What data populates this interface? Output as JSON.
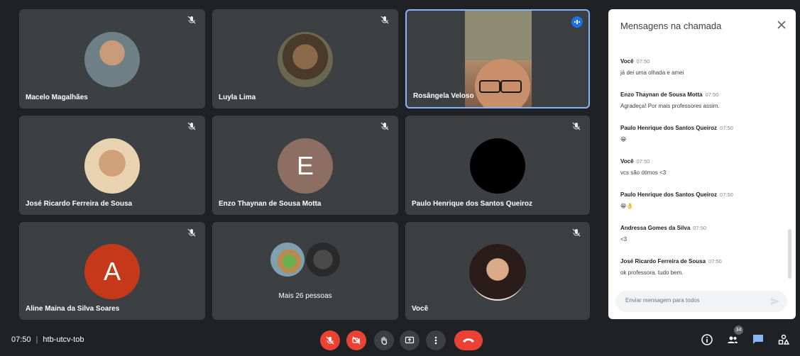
{
  "participants": [
    {
      "name": "Macelo Magalhães"
    },
    {
      "name": "Luyla Lima"
    },
    {
      "name": "Rosângela Veloso"
    },
    {
      "name": "José Ricardo Ferreira de Sousa"
    },
    {
      "name": "Enzo Thaynan de Sousa Motta",
      "initial": "E"
    },
    {
      "name": "Paulo Henrique dos Santos Queiroz"
    },
    {
      "name": "Aline Maina da Silva Soares",
      "initial": "A"
    },
    {
      "more_label": "Mais 26 pessoas"
    },
    {
      "name": "Você"
    }
  ],
  "chat": {
    "title": "Mensagens na chamada",
    "messages": [
      {
        "sender": "Você",
        "time": "07:50",
        "text": "já dei uma olhada e amei"
      },
      {
        "sender": "Enzo Thaynan de Sousa Motta",
        "time": "07:50",
        "text": "Agradeça! Por mais professores assim."
      },
      {
        "sender": "Paulo Henrique dos Santos Queiroz",
        "time": "07:50",
        "text": "😁"
      },
      {
        "sender": "Você",
        "time": "07:50",
        "text": "vcs são ótimos <3"
      },
      {
        "sender": "Paulo Henrique dos Santos Queiroz",
        "time": "07:50",
        "text": "😁👌"
      },
      {
        "sender": "Andressa Gomes da Silva",
        "time": "07:50",
        "text": "<3"
      },
      {
        "sender": "José Ricardo Ferreira de Sousa",
        "time": "07:50",
        "text": "ok professora. tudo bem."
      }
    ],
    "input_placeholder": "Enviar mensagem para todos"
  },
  "meeting": {
    "time": "07:50",
    "code": "htb-utcv-tob"
  },
  "people_count": "34",
  "colors": {
    "background": "#202124",
    "tile": "#3c4043",
    "red": "#ea4335",
    "blue": "#1a73e8",
    "avatar_e": "#8d6e63",
    "avatar_a": "#c5391a"
  }
}
